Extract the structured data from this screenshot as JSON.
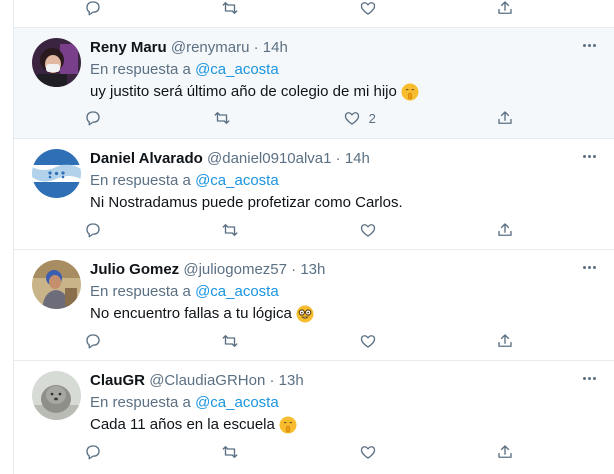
{
  "tweets": [
    {
      "name": "Reny Maru",
      "handle": "@renymaru",
      "separator": "·",
      "time": "14h",
      "reply_prefix": "En respuesta a",
      "reply_to": "@ca_acosta",
      "text": "uy justito será último año de colegio de mi hijo",
      "emoji": "shushing-face-emoji",
      "likes": "2",
      "avatar": "woman-selfie-avatar"
    },
    {
      "name": "Daniel Alvarado",
      "handle": "@daniel0910alva1",
      "separator": "·",
      "time": "14h",
      "reply_prefix": "En respuesta a",
      "reply_to": "@ca_acosta",
      "text": "Ni Nostradamus puede profetizar como Carlos.",
      "emoji": "",
      "likes": "",
      "avatar": "honduras-flag-avatar"
    },
    {
      "name": "Julio Gomez",
      "handle": "@juliogomez57",
      "separator": "·",
      "time": "13h",
      "reply_prefix": "En respuesta a",
      "reply_to": "@ca_acosta",
      "text": "No encuentro fallas a tu lógica",
      "emoji": "nerd-face-emoji",
      "likes": "",
      "avatar": "man-photo-avatar"
    },
    {
      "name": "ClauGR",
      "handle": "@ClaudiaGRHon",
      "separator": "·",
      "time": "13h",
      "reply_prefix": "En respuesta a",
      "reply_to": "@ca_acosta",
      "text": "Cada 11 años en la escuela",
      "emoji": "shushing-face-emoji",
      "likes": "",
      "avatar": "dog-photo-avatar"
    }
  ],
  "icons": {
    "reply": "reply-icon",
    "retweet": "retweet-icon",
    "like": "like-icon",
    "share": "share-icon",
    "more": "more-icon"
  },
  "colors": {
    "mention": "#1b95e0",
    "secondary_text": "#5b7083",
    "hover_background": "#f5f8fa",
    "divider": "#e6ecf0"
  }
}
